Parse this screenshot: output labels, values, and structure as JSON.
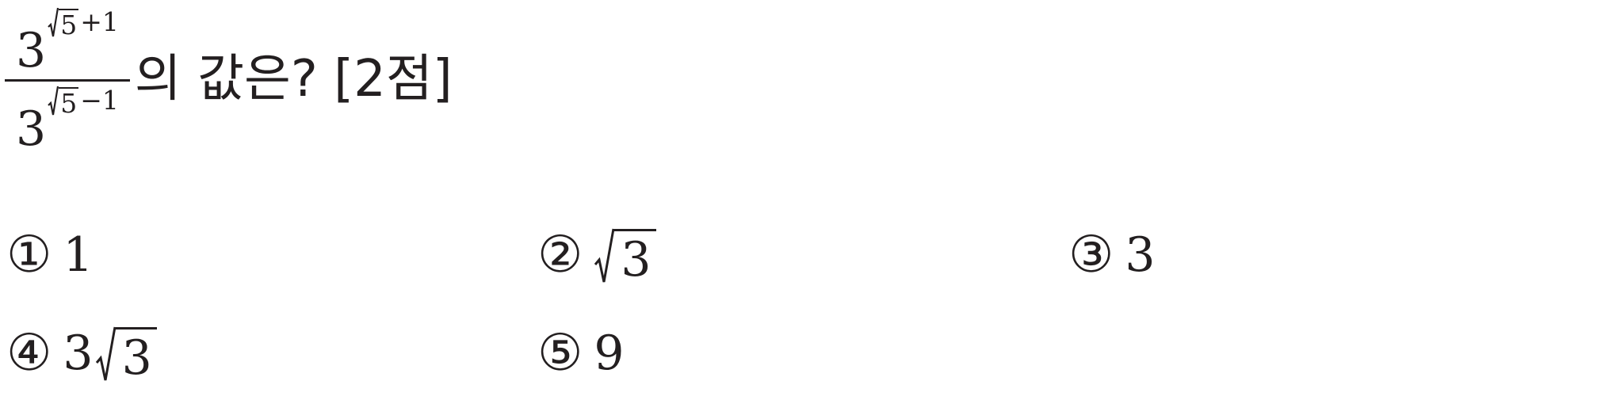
{
  "question": {
    "numerator": {
      "base": "3",
      "exp_radicand": "5",
      "exp_op": "+1"
    },
    "denominator": {
      "base": "3",
      "exp_radicand": "5",
      "exp_op": "−1"
    },
    "text": "의 값은? [2점]"
  },
  "choices": [
    {
      "num": "①",
      "value": "1"
    },
    {
      "num": "②",
      "radicand": "3"
    },
    {
      "num": "③",
      "value": "3"
    },
    {
      "num": "④",
      "coef": "3",
      "radicand": "3"
    },
    {
      "num": "⑤",
      "value": "9"
    }
  ]
}
